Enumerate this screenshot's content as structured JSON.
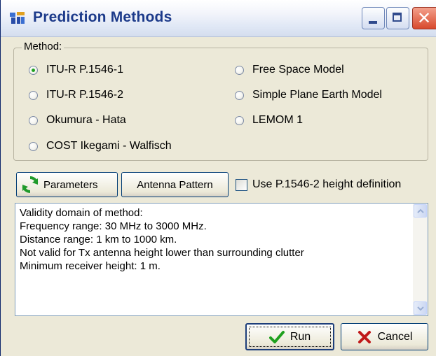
{
  "window": {
    "title": "Prediction Methods"
  },
  "method_group": {
    "legend": "Method:",
    "options": [
      {
        "label": "ITU-R P.1546-1",
        "checked": true
      },
      {
        "label": "ITU-R P.1546-2",
        "checked": false
      },
      {
        "label": "Okumura - Hata",
        "checked": false
      },
      {
        "label": "COST Ikegami - Walfisch",
        "checked": false
      },
      {
        "label": "Free Space Model",
        "checked": false
      },
      {
        "label": "Simple Plane Earth Model",
        "checked": false
      },
      {
        "label": "LEMOM 1",
        "checked": false
      }
    ]
  },
  "toolbar": {
    "parameters_label": "Parameters",
    "antenna_pattern_label": "Antenna Pattern",
    "use_height_label": "Use P.1546-2 height definition",
    "use_height_checked": false
  },
  "validity": {
    "lines": [
      "Validity domain of method:",
      "Frequency range: 30 MHz to 3000 MHz.",
      "Distance range: 1 km to 1000 km.",
      "Not valid for Tx antenna height lower than surrounding clutter",
      "Minimum receiver height: 1 m."
    ]
  },
  "actions": {
    "run_label": "Run",
    "cancel_label": "Cancel"
  },
  "colors": {
    "accent": "#21a121",
    "close": "#d8492c",
    "title_text": "#1c3a8a",
    "dialog_bg": "#ece9d8"
  },
  "icons": [
    "app-icon",
    "minimize-icon",
    "maximize-icon",
    "close-icon",
    "refresh-icon",
    "checkmark-icon",
    "cancel-x-icon",
    "scroll-up-icon",
    "scroll-down-icon"
  ]
}
